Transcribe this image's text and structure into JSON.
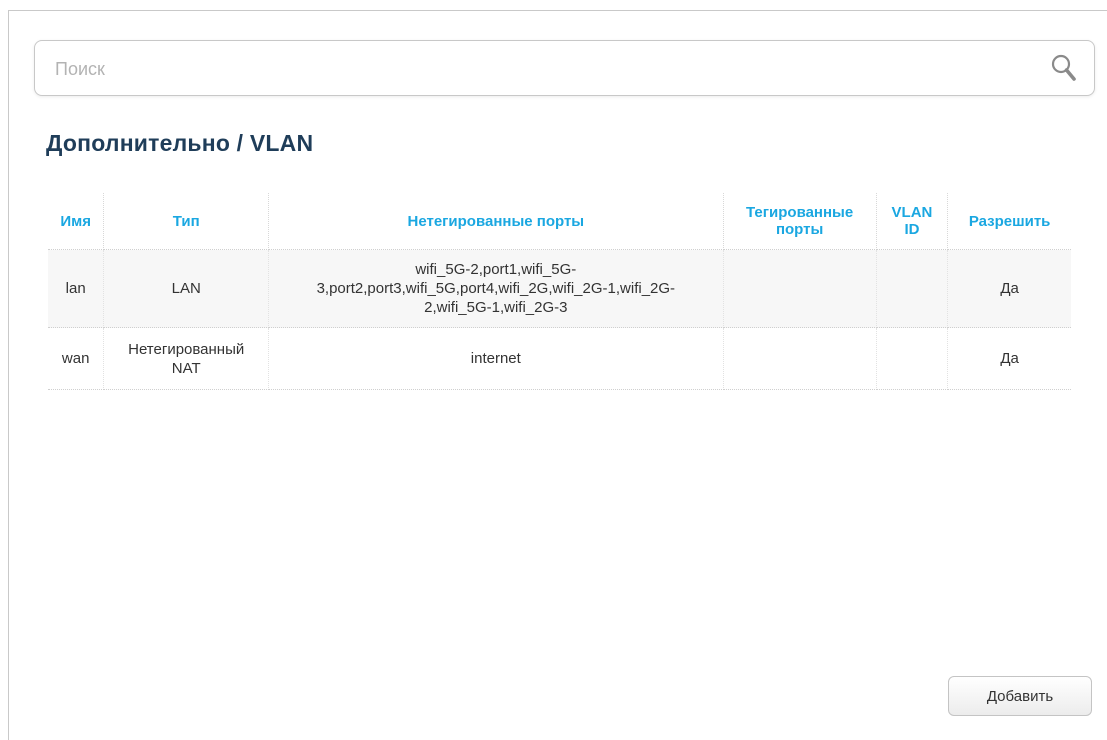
{
  "search": {
    "placeholder": "Поиск",
    "value": ""
  },
  "header": {
    "title": "Дополнительно /  VLAN"
  },
  "table": {
    "columns": [
      "Имя",
      "Тип",
      "Нетегированные порты",
      "Тегированные порты",
      "VLAN ID",
      "Разрешить"
    ],
    "rows": [
      {
        "name": "lan",
        "type": "LAN",
        "untagged": "wifi_5G-2,port1,wifi_5G-3,port2,port3,wifi_5G,port4,wifi_2G,wifi_2G-1,wifi_2G-2,wifi_5G-1,wifi_2G-3",
        "tagged": "",
        "vlan_id": "",
        "enabled": "Да"
      },
      {
        "name": "wan",
        "type": "Нетегированный NAT",
        "untagged": "internet",
        "tagged": "",
        "vlan_id": "",
        "enabled": "Да"
      }
    ]
  },
  "actions": {
    "add_label": "Добавить"
  },
  "colors": {
    "title": "#1f3d59",
    "header_text": "#1aa7e1",
    "border": "#c8c8c8"
  }
}
